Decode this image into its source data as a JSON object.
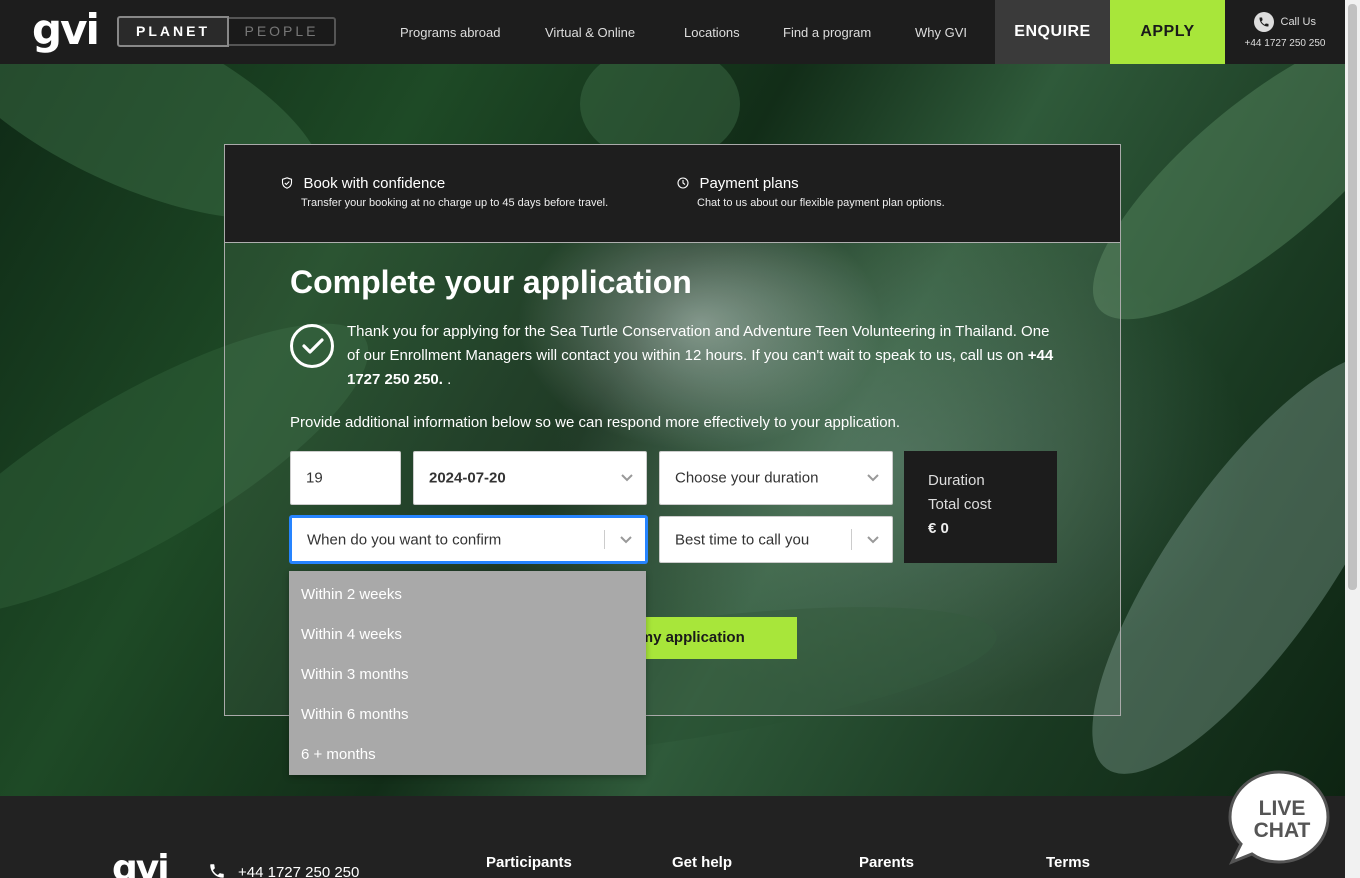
{
  "header": {
    "logo": "gvi",
    "toggle": {
      "planet": "PLANET",
      "people": "PEOPLE"
    },
    "nav": [
      {
        "label": "Programs abroad"
      },
      {
        "label": "Virtual & Online"
      },
      {
        "label": "Locations"
      },
      {
        "label": "Find a program"
      },
      {
        "label": "Why GVI"
      }
    ],
    "enquire": "ENQUIRE",
    "apply": "APPLY",
    "call": {
      "label": "Call Us",
      "number": "+44 1727 250 250"
    }
  },
  "info": {
    "book": {
      "title": "Book with confidence",
      "desc": "Transfer your booking at no charge up to 45 days before travel."
    },
    "payment": {
      "title": "Payment plans",
      "desc": "Chat to us about our flexible payment plan options."
    }
  },
  "application": {
    "title": "Complete your application",
    "thanks_text": "Thank you for applying for the Sea Turtle Conservation and Adventure Teen Volunteering in Thailand. One of our Enrollment Managers will contact you within 12 hours. If you can't wait to speak to us, call us on ",
    "thanks_phone": "+44 1727 250 250.",
    "thanks_end": " .",
    "provide": "Provide additional information below so we can respond more effectively to your application.",
    "fields": {
      "age": "19",
      "start_date": "2024-07-20",
      "duration": "Choose your duration",
      "confirm": "When do you want to confirm",
      "call_time": "Best time to call you"
    },
    "summary": {
      "duration": "Duration",
      "total_cost": "Total cost",
      "cost_value": "€ 0"
    },
    "submit": "Complete my application",
    "confirm_options": [
      "Within 2 weeks",
      "Within 4 weeks",
      "Within 3 months",
      "Within 6 months",
      "6 + months"
    ]
  },
  "footer": {
    "logo": "gvi",
    "phone": "+44 1727 250 250",
    "columns": [
      "Participants",
      "Get help",
      "Parents",
      "Terms"
    ]
  },
  "livechat": {
    "line1": "LIVE",
    "line2": "CHAT"
  },
  "colors": {
    "accent_green": "#a8e63a",
    "focus_blue": "#2684ff",
    "header_bg": "#1d1d1d"
  }
}
